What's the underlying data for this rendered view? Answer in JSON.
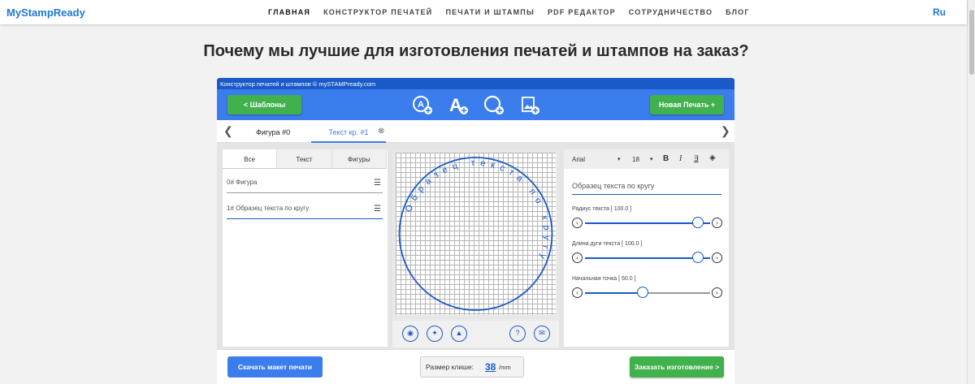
{
  "nav": {
    "brand": "MyStampReady",
    "menu": [
      "ГЛАВНАЯ",
      "КОНСТРУКТОР ПЕЧАТЕЙ",
      "ПЕЧАТИ И ШТАМПЫ",
      "PDF РЕДАКТОР",
      "СОТРУДНИЧЕСТВО",
      "БЛОГ"
    ],
    "active_index": 0,
    "lang": "Ru"
  },
  "headline": "Почему мы лучшие для изготовления печатей и штампов на заказ?",
  "app": {
    "title": "Конструктор печатей и штампов © mySTAMPready.com",
    "templates_button": "<  Шаблоны",
    "new_stamp_button": "Новая Печать +",
    "tools": [
      "add-text-circle-icon",
      "add-text-icon",
      "add-circle-icon",
      "add-image-icon"
    ],
    "tabs": [
      {
        "label": "Фигура #0"
      },
      {
        "label": "Текст кр. #1",
        "active": true
      }
    ],
    "left_panel": {
      "subtabs": [
        "Все",
        "Текст",
        "Фигуры"
      ],
      "layers": [
        "0#  Фигура",
        "1#  Образец текста по кругу"
      ]
    },
    "canvas": {
      "circle_text": "Образец текста по кругу"
    },
    "right_panel": {
      "font": "Arial",
      "size": "18",
      "bold": "B",
      "italic": "I",
      "text_value": "Образец текста по кругу",
      "sliders": [
        {
          "label": "Радиус текста [ 100.0 ]",
          "value": 100
        },
        {
          "label": "Длина дуги текста [ 100.0 ]",
          "value": 100
        },
        {
          "label": "Начальная точка [ 50.0 ]",
          "value": 50
        }
      ]
    },
    "bottom": {
      "download_button": "Скачать макет печати",
      "size_label": "Размер клише:",
      "size_value": "38",
      "size_unit": "/mm",
      "order_button": "Заказать изготовление >"
    }
  },
  "colors": {
    "accent": "#3b7ded",
    "green": "#41b14d",
    "dark_blue": "#1a5ac8"
  }
}
